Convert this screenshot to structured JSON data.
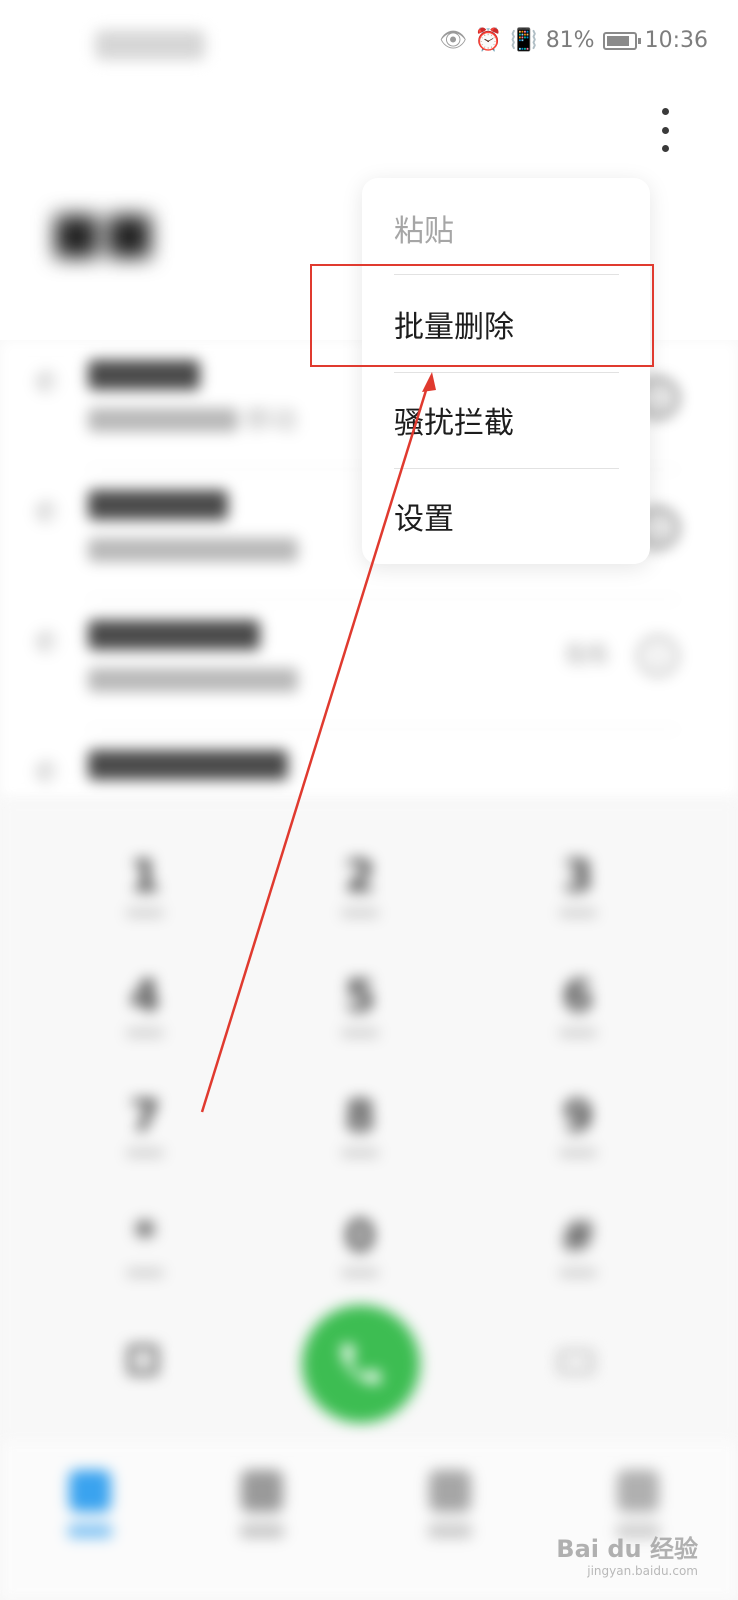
{
  "status_bar": {
    "battery_percent": "81%",
    "time": "10:36"
  },
  "call_list": {
    "rows": [
      {
        "sub_text": "移动",
        "count": ""
      },
      {
        "sub_text": "",
        "count": ""
      },
      {
        "sub_text": "",
        "count": "8/6"
      },
      {
        "sub_text": "",
        "count": ""
      }
    ]
  },
  "menu": {
    "items": [
      {
        "label": "粘贴",
        "enabled": false
      },
      {
        "label": "批量删除",
        "enabled": true
      },
      {
        "label": "骚扰拦截",
        "enabled": true
      },
      {
        "label": "设置",
        "enabled": true
      }
    ]
  },
  "dialpad": {
    "keys": [
      "1",
      "2",
      "3",
      "4",
      "5",
      "6",
      "7",
      "8",
      "9",
      "*",
      "0",
      "#"
    ]
  },
  "watermark": {
    "text": "Bai du 经验",
    "sub": "jingyan.baidu.com"
  },
  "colors": {
    "call_green": "#3dbd52",
    "annotation_red": "#e03a2f",
    "nav_active_blue": "#3aa3ef"
  }
}
